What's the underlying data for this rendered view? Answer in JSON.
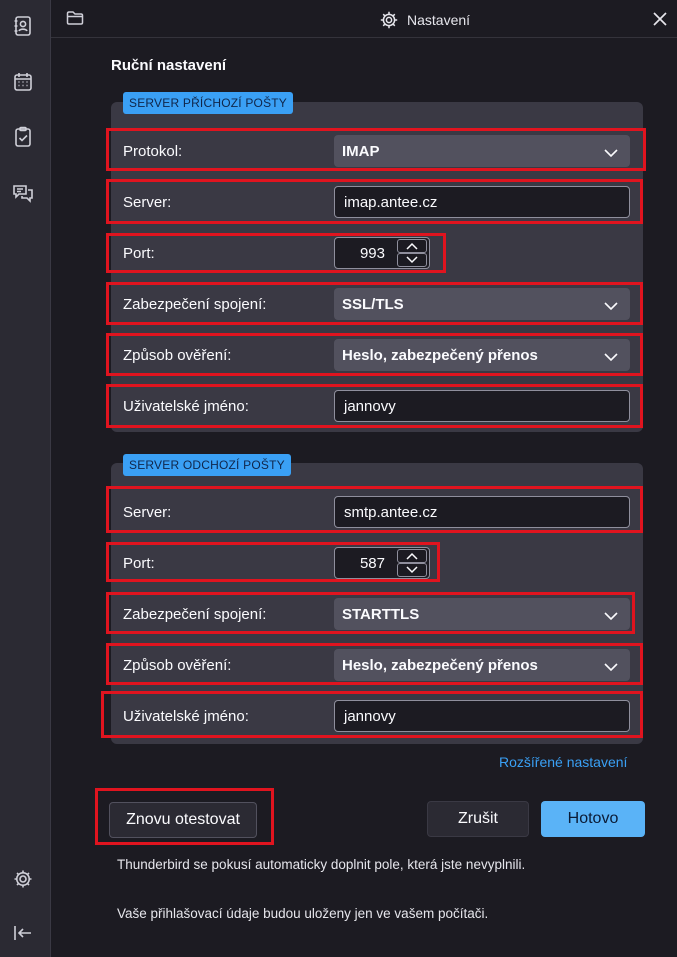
{
  "window": {
    "title": "Nastavení"
  },
  "page": {
    "section_title": "Ruční nastavení"
  },
  "incoming": {
    "legend": "SERVER PŘÍCHOZÍ POŠTY",
    "protocol_label": "Protokol:",
    "protocol_value": "IMAP",
    "server_label": "Server:",
    "server_value": "imap.antee.cz",
    "port_label": "Port:",
    "port_value": "993",
    "security_label": "Zabezpečení spojení:",
    "security_value": "SSL/TLS",
    "auth_label": "Způsob ověření:",
    "auth_value": "Heslo, zabezpečený přenos",
    "username_label": "Uživatelské jméno:",
    "username_value": "jannovy"
  },
  "outgoing": {
    "legend": "SERVER ODCHOZÍ POŠTY",
    "server_label": "Server:",
    "server_value": "smtp.antee.cz",
    "port_label": "Port:",
    "port_value": "587",
    "security_label": "Zabezpečení spojení:",
    "security_value": "STARTTLS",
    "auth_label": "Způsob ověření:",
    "auth_value": "Heslo, zabezpečený přenos",
    "username_label": "Uživatelské jméno:",
    "username_value": "jannovy"
  },
  "advanced_link": "Rozšířené nastavení",
  "buttons": {
    "retest": "Znovu otestovat",
    "cancel": "Zrušit",
    "done": "Hotovo"
  },
  "notes": {
    "autofill": "Thunderbird se pokusí automaticky doplnit pole, která jste nevyplnili.",
    "storage": "Vaše přihlašovací údaje budou uloženy jen ve vašem počítači."
  },
  "icons": {
    "spaces": [
      "address-book-icon",
      "calendar-icon",
      "tasks-icon",
      "chat-icon",
      "settings-icon",
      "collapse-icon"
    ],
    "status": "online-status-icon",
    "titlebar": [
      "folder-icon",
      "gear-icon",
      "close-icon"
    ]
  },
  "colors": {
    "accent": "#3aa0f5",
    "highlight": "#e0141f",
    "primary_button": "#5ab3f7"
  }
}
